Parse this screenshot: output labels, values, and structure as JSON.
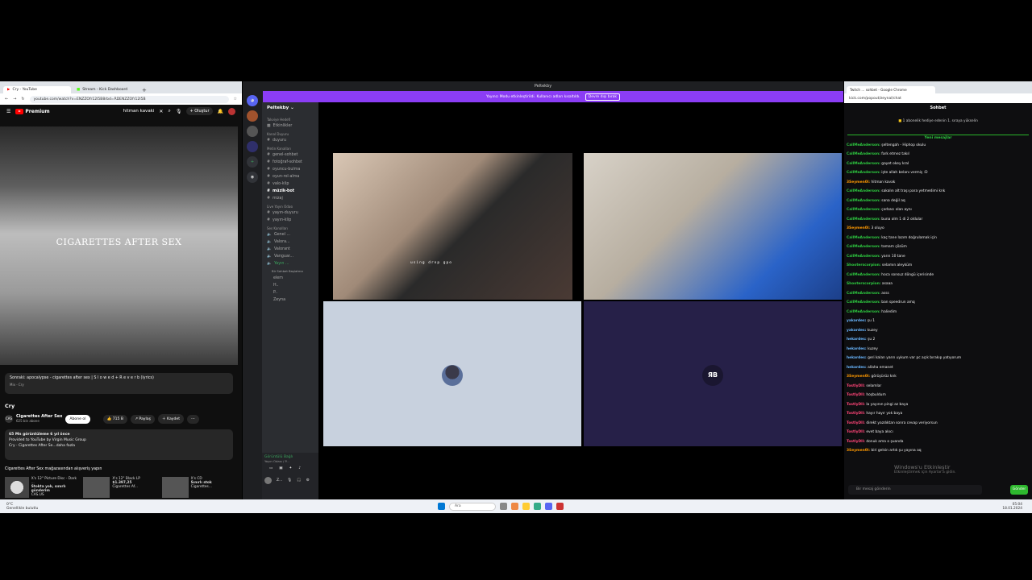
{
  "youtube": {
    "tabs": [
      "Cry - YouTube",
      "Stream - Kick Dashboard"
    ],
    "url": "youtube.com/watch?v=ENZZOfr12I5B8rbd=RDENZZOfr12I5B",
    "logo": "Premium",
    "search": "hitman kavaki",
    "create": "Oluştur",
    "video_text": "CIGARETTES AFTER SEX",
    "next_label": "Sonraki: apocalypse - cigarettes after sex | S l o w e d + R e v e r b (lyrics)",
    "next_mix": "Mix - Cry",
    "title": "Cry",
    "channel": "Cigarettes After Sex",
    "subs": "625 bin abone",
    "subscribe": "Abone ol",
    "likes": "715 B",
    "share": "Paylaş",
    "save": "Kaydet",
    "desc_line1": "65 Mn görüntüleme  6 yıl önce",
    "desc_line2": "Provided to YouTube by Virgin Music Group",
    "desc_line3": "Cry · Cigarettes After Se...daha fazla",
    "shop_title": "Cigarettes After Sex mağazasından alışveriş yapın",
    "products": [
      {
        "name": "X's 12\" Picture Disc - Dark ...",
        "price": "Stokta yok, sınırlı gönderim",
        "store": "CAS.US"
      },
      {
        "name": "X's 12\" Black LP",
        "price": "$1.397,25",
        "store": "Cigarettes Af..."
      },
      {
        "name": "X's CD",
        "price": "Sınırlı stok",
        "store": "Cigarettes..."
      }
    ]
  },
  "discord": {
    "window_title": "Peltekby",
    "banner": "Yayıncı Modu etkinleştirildi. Kullanıcı adları kısaltıldı.",
    "banner_btn": "Devre dışı bırak",
    "server": "Peltekby",
    "cats": [
      {
        "label": "Takviye Hedefi",
        "items": []
      },
      {
        "label": "",
        "items": [
          "Etkinlikler"
        ]
      },
      {
        "label": "Kanal Duyuru",
        "items": [
          "duyuru"
        ]
      },
      {
        "label": "Metin Kanalları",
        "items": [
          "genel-sohbet",
          "fotoğraf-sohbet",
          "oyuncu-bulma",
          "oyun-rol-alma",
          "valo-klip",
          "müzik-bot",
          "mizaj"
        ]
      },
      {
        "label": "Live Yayın Odası",
        "items": [
          "yayın-duyuru",
          "yayın-klip"
        ]
      },
      {
        "label": "Ses Kanalları",
        "items": [
          "Genel ...",
          "Valora...",
          "Valorant",
          "Vanguar...",
          "Yayın ..."
        ]
      }
    ],
    "voice_members": [
      "Bir Sohbet Başlatma",
      "elem",
      "H..",
      "P..",
      "Zeyna"
    ],
    "connected": "Görüntülü Bağlı",
    "connected_sub": "Yayın Odası / P...",
    "user": "Z...",
    "caption": "using drop gpo",
    "tile4_logo": "ЯB"
  },
  "twitch": {
    "tab": "Twitch ... sohbet - Google Chrome",
    "url": "kick.com/popout/zeynal/chat",
    "header": "Sohbet",
    "gift": "1 abonelik hediye edenin 1. sıraya yükselin",
    "new_msgs": "Yeni mesajlar",
    "messages": [
      {
        "user": "CallMeAnderson:",
        "text": "şeltengah - Hiphop okulu",
        "color": "#2ecc40"
      },
      {
        "user": "CallMeAnderson:",
        "text": "fark etmez takıl",
        "color": "#2ecc40"
      },
      {
        "user": "CallMeAnderson:",
        "text": "gayet okey kral",
        "color": "#2ecc40"
      },
      {
        "user": "CallMeAnderson:",
        "text": "işte allah belanı vermiş :D",
        "color": "#2ecc40"
      },
      {
        "user": "3Seymen0l:",
        "text": "hitman kavak",
        "color": "#ff9900"
      },
      {
        "user": "CallMeAnderson:",
        "text": "sakalın alt traşı para yetmedimi knk",
        "color": "#2ecc40"
      },
      {
        "user": "CallMeAnderson:",
        "text": "sana değil aq",
        "color": "#2ecc40"
      },
      {
        "user": "CallMeAnderson:",
        "text": "çorbacı olan aynı",
        "color": "#2ecc40"
      },
      {
        "user": "CallMeAnderson:",
        "text": "buna olm 1 di 2 oldular",
        "color": "#2ecc40"
      },
      {
        "user": "3Seymen0l:",
        "text": "3 oluyo",
        "color": "#ff9900"
      },
      {
        "user": "CallMeAnderson:",
        "text": "kaç tane lazım doğrulamak için",
        "color": "#2ecc40"
      },
      {
        "user": "CallMeAnderson:",
        "text": "tamam çözüm",
        "color": "#2ecc40"
      },
      {
        "user": "CallMeAnderson:",
        "text": "yarın 10 tane",
        "color": "#2ecc40"
      },
      {
        "user": "Shooterscorpion:",
        "text": "selamın aleyküm",
        "color": "#2ecc40"
      },
      {
        "user": "CallMeAnderson:",
        "text": "hoca sonsuz döngü içerisinde",
        "color": "#2ecc40"
      },
      {
        "user": "Shooterscorpion:",
        "text": "asaaa",
        "color": "#2ecc40"
      },
      {
        "user": "CallMeAnderson:",
        "text": "asss",
        "color": "#2ecc40"
      },
      {
        "user": "CallMeAnderson:",
        "text": "ban speedrun amq",
        "color": "#2ecc40"
      },
      {
        "user": "CallMeAnderson:",
        "text": "haliedim",
        "color": "#2ecc40"
      },
      {
        "user": "yakardes:",
        "text": "şu 1",
        "color": "#6ab7ff"
      },
      {
        "user": "yakardes:",
        "text": "kuzey",
        "color": "#6ab7ff"
      },
      {
        "user": "hekardes:",
        "text": "şu 2",
        "color": "#6ab7ff"
      },
      {
        "user": "hekardes:",
        "text": "kuzey",
        "color": "#6ab7ff"
      },
      {
        "user": "hekardes:",
        "text": "geri kalan yarın uykum var pc açık bırakıp yatıyorum",
        "color": "#6ab7ff"
      },
      {
        "user": "hekardes:",
        "text": "allaha emanet",
        "color": "#6ab7ff"
      },
      {
        "user": "3Seymen0l:",
        "text": "görüşürüz knk",
        "color": "#ff9900"
      },
      {
        "user": "TostlyDll:",
        "text": "selamlar",
        "color": "#ff4477"
      },
      {
        "user": "TostlyDll:",
        "text": "hoşbuldum",
        "color": "#ff4477"
      },
      {
        "user": "TostlyDll:",
        "text": "la yayının pingi az baya",
        "color": "#ff4477"
      },
      {
        "user": "TostlyDll:",
        "text": "hayır hayır yok baya",
        "color": "#ff4477"
      },
      {
        "user": "TostlyDll:",
        "text": "direkt yazdıktan sonra cevap veriyorsun",
        "color": "#ff4477"
      },
      {
        "user": "TostlyDll:",
        "text": "evet baya akıcı",
        "color": "#ff4477"
      },
      {
        "user": "TostlyDll:",
        "text": "donuk ama o şuanda",
        "color": "#ff4477"
      },
      {
        "user": "3Seymen0l:",
        "text": "biri gelsin artık şu yayına aq",
        "color": "#ff9900"
      }
    ],
    "input_placeholder": "Bir mesaj gönderin",
    "send": "Gönder",
    "watermark": "Windows'u Etkinleştir",
    "watermark_sub": "Etkinleştirmek için Ayarlar'a gidin."
  },
  "taskbar": {
    "weather_temp": "0°C",
    "weather_desc": "Genellikle bulutlu",
    "search": "Ara",
    "time": "05:04",
    "date": "18.01.2024"
  }
}
